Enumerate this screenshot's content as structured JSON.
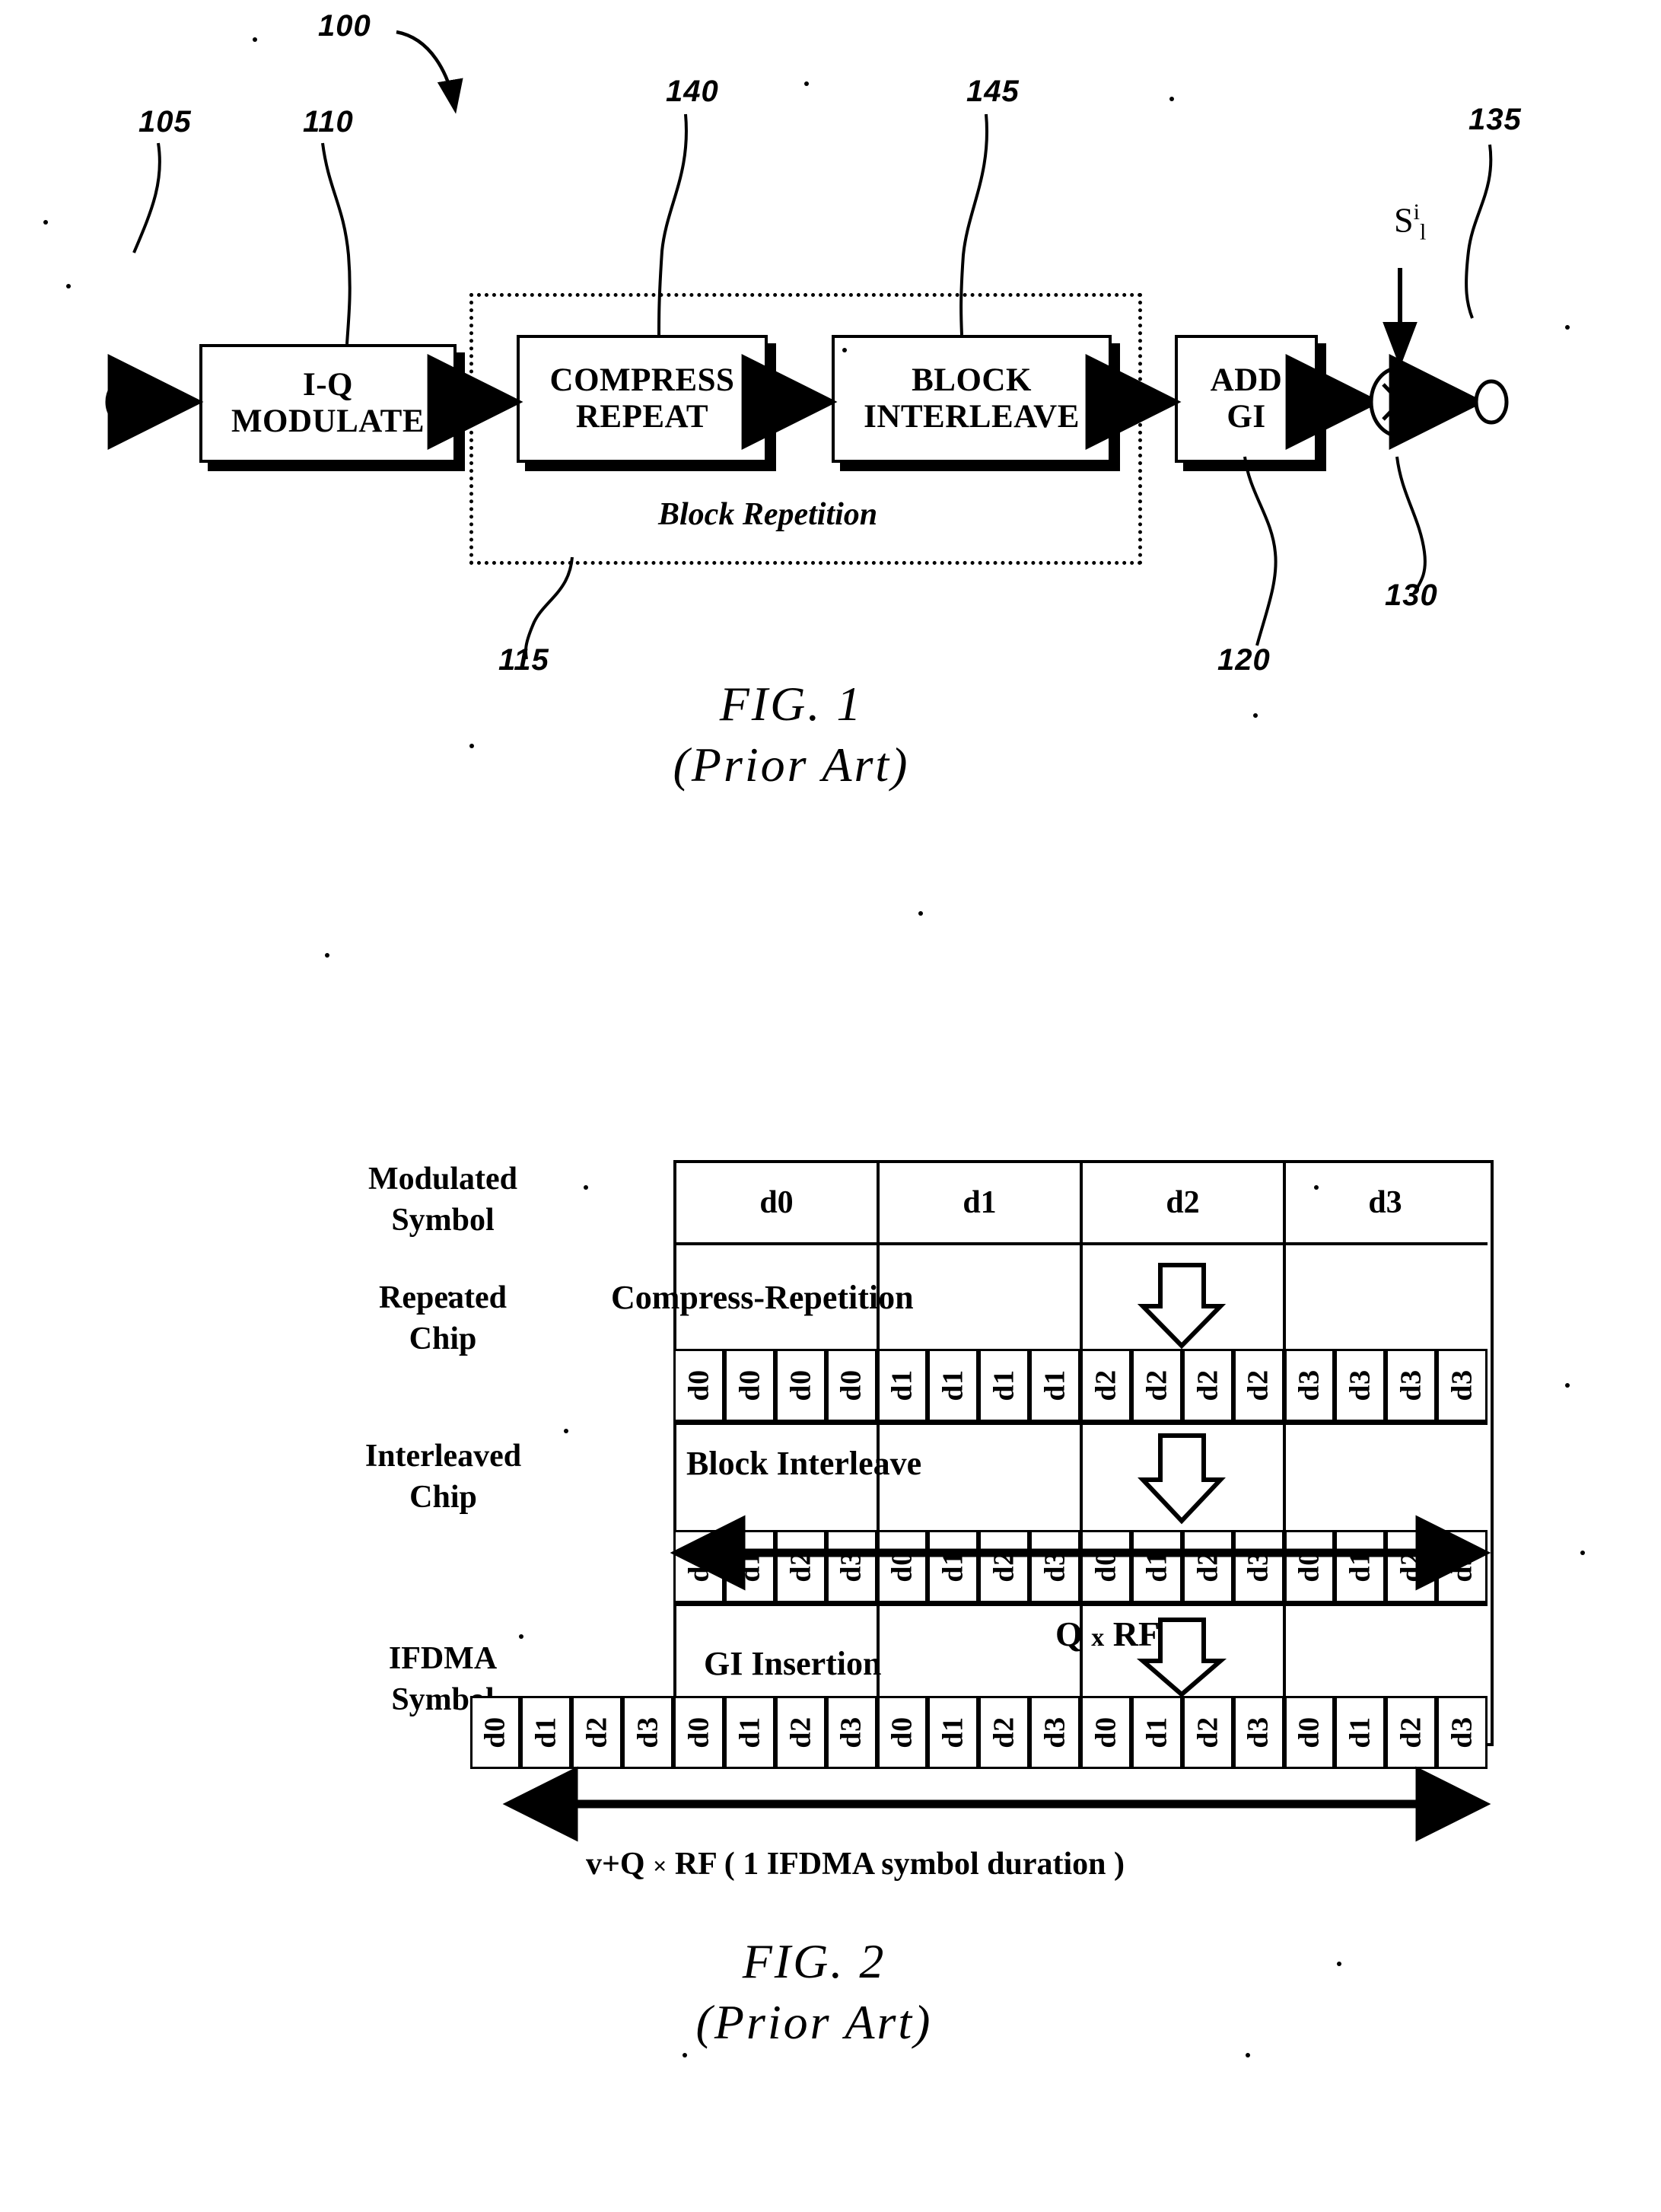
{
  "figures": [
    {
      "id": "fig1",
      "caption_line1": "FIG. 1",
      "caption_line2": "(Prior Art)",
      "system_ref": "100",
      "blocks": [
        {
          "ref": "110",
          "line1": "I-Q",
          "line2": "MODULATE"
        },
        {
          "ref": "140",
          "line1": "COMPRESS",
          "line2": "REPEAT"
        },
        {
          "ref": "145",
          "line1": "BLOCK",
          "line2": "INTERLEAVE"
        },
        {
          "ref": "120",
          "line1": "ADD",
          "line2": "GI"
        }
      ],
      "group_box": {
        "ref": "115",
        "label": "Block Repetition"
      },
      "input_node_ref": "105",
      "output_node_ref": "135",
      "multiplier": {
        "ref": "130",
        "symbol": "X"
      },
      "multiplier_input_signal": {
        "base": "S",
        "sup": "i",
        "sub": "l"
      }
    },
    {
      "id": "fig2",
      "caption_line1": "FIG. 2",
      "caption_line2": "(Prior Art)",
      "row_labels": [
        {
          "line1": "Modulated",
          "line2": "Symbol"
        },
        {
          "line1": "Repeated",
          "line2": "Chip"
        },
        {
          "line1": "Interleaved",
          "line2": "Chip"
        },
        {
          "line1": "IFDMA",
          "line2": "Symbol"
        }
      ],
      "operations": [
        "Compress-Repetition",
        "Block Interleave",
        "GI Insertion"
      ],
      "modulated_symbols": [
        "d0",
        "d1",
        "d2",
        "d3"
      ],
      "repeated_chips": [
        "d0",
        "d0",
        "d0",
        "d0",
        "d1",
        "d1",
        "d1",
        "d1",
        "d2",
        "d2",
        "d2",
        "d2",
        "d3",
        "d3",
        "d3",
        "d3"
      ],
      "interleaved_chips": [
        "d0",
        "d1",
        "d2",
        "d3",
        "d0",
        "d1",
        "d2",
        "d3",
        "d0",
        "d1",
        "d2",
        "d3",
        "d0",
        "d1",
        "d2",
        "d3"
      ],
      "ifdma_guard_interval_chips": [
        "d0",
        "d1",
        "d2",
        "d3"
      ],
      "ifdma_symbol_chips": [
        "d0",
        "d1",
        "d2",
        "d3",
        "d0",
        "d1",
        "d2",
        "d3",
        "d0",
        "d1",
        "d2",
        "d3",
        "d0",
        "d1",
        "d2",
        "d3"
      ],
      "span_label_top": {
        "q": "Q",
        "times": "x",
        "rf": "RF"
      },
      "span_label_bottom": {
        "prefix": "v+Q",
        "times": "×",
        "rf": "RF",
        "paren": "( 1 IFDMA symbol duration )"
      }
    }
  ],
  "colors": {
    "ink": "#000000",
    "paper": "#ffffff"
  }
}
